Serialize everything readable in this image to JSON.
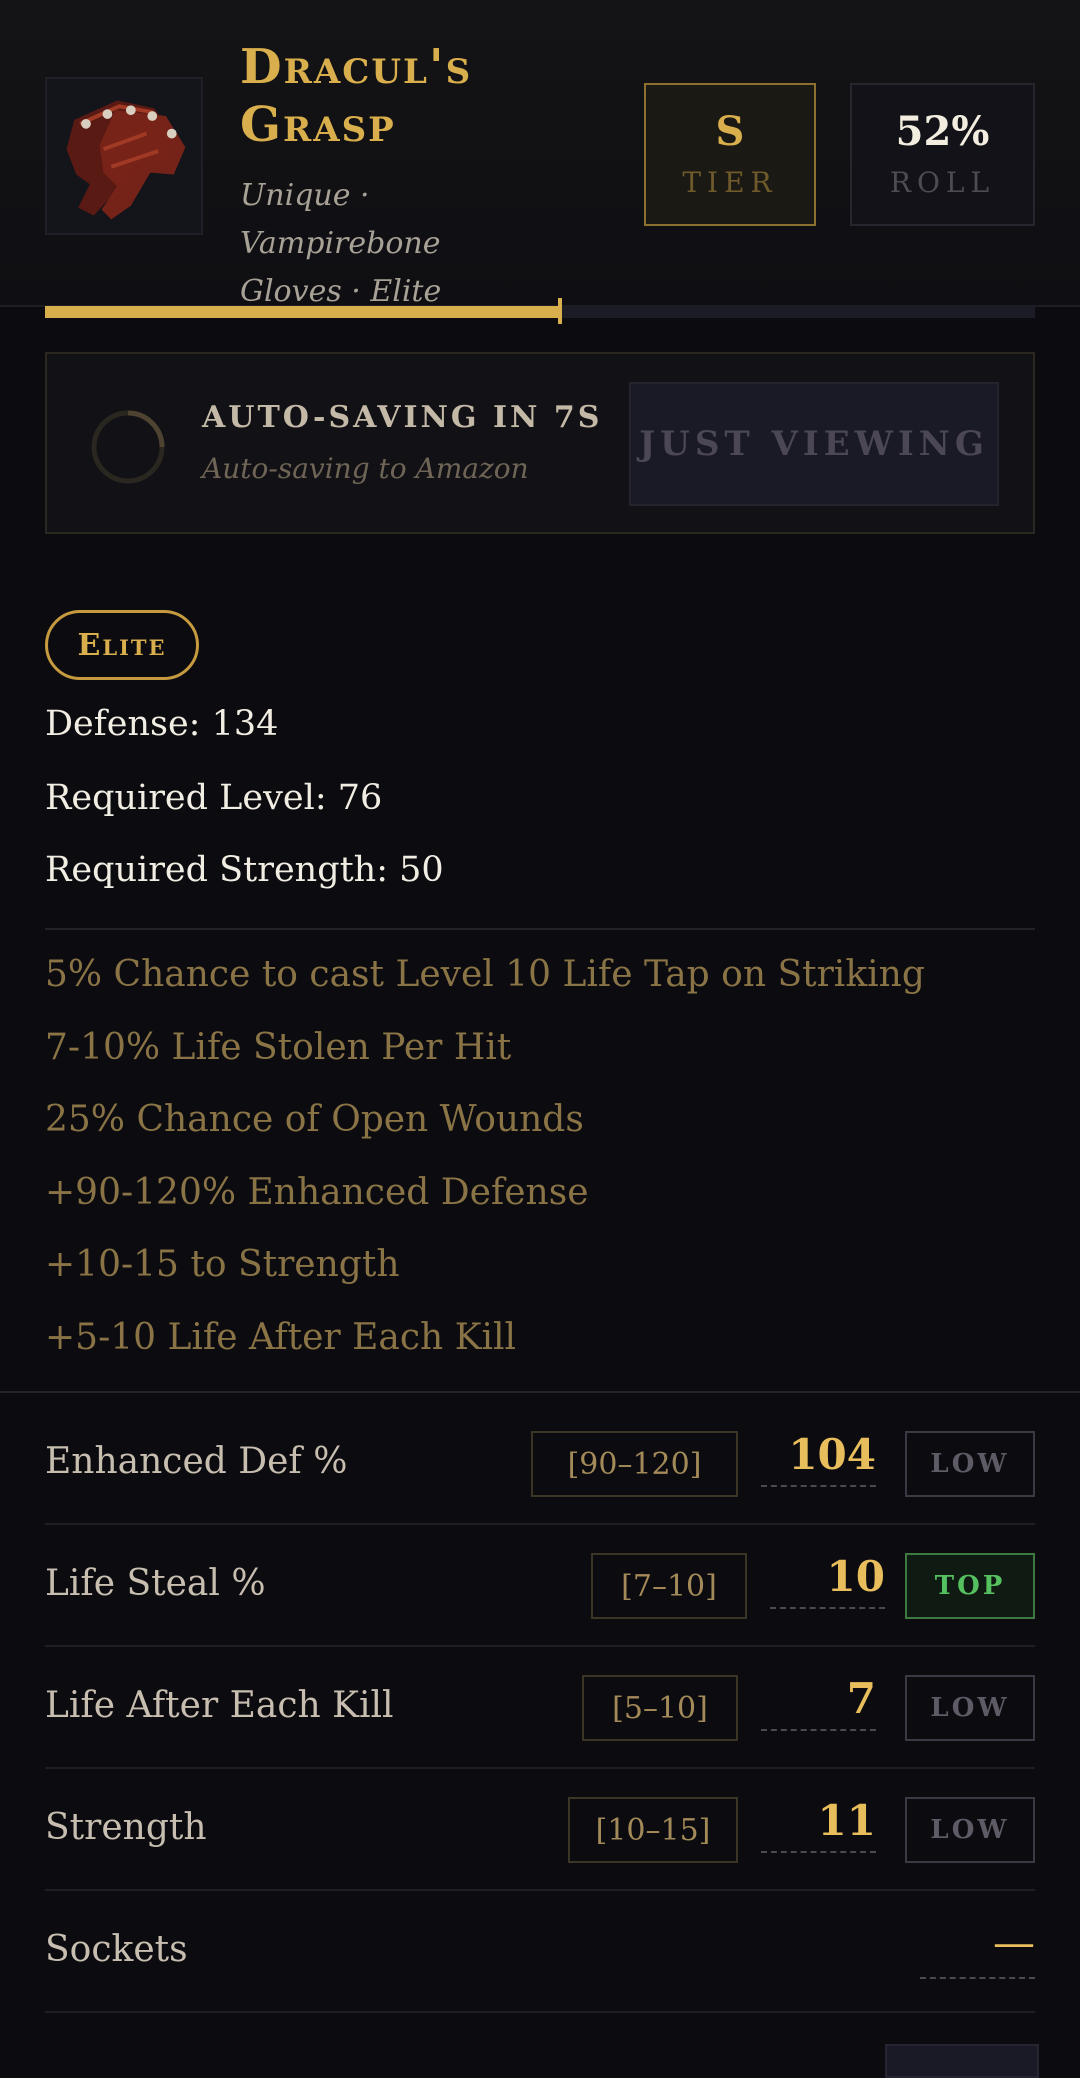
{
  "item": {
    "title_line1": "Dracul's",
    "title_line2": "Grasp",
    "subtitle_line1": "Unique · Vampirebone",
    "subtitle_line2": "Gloves · Elite",
    "icon": "gloves-item-icon"
  },
  "tier": {
    "value": "S",
    "label": "TIER"
  },
  "roll": {
    "value": "52%",
    "label": "ROLL",
    "fraction": 0.52
  },
  "autosave": {
    "title": "AUTO-SAVING IN 7S",
    "subtitle": "Auto-saving to Amazon",
    "button_label": "JUST VIEWING"
  },
  "badge": "Elite",
  "base_stats": [
    "Defense: 134",
    "Required Level: 76",
    "Required Strength: 50"
  ],
  "mods": [
    "5% Chance to cast Level 10 Life Tap on Striking",
    "7-10% Life Stolen Per Hit",
    "25% Chance of Open Wounds",
    "+90-120% Enhanced Defense",
    "+10-15 to Strength",
    "+5-10 Life After Each Kill"
  ],
  "rolls": [
    {
      "label": "Enhanced Def %",
      "range": "[90–120]",
      "value": "104",
      "rating": "LOW"
    },
    {
      "label": "Life Steal %",
      "range": "[7–10]",
      "value": "10",
      "rating": "TOP"
    },
    {
      "label": "Life After Each Kill",
      "range": "[5–10]",
      "value": "7",
      "rating": "LOW"
    },
    {
      "label": "Strength",
      "range": "[10–15]",
      "value": "11",
      "rating": "LOW"
    }
  ],
  "sockets": {
    "label": "Sockets",
    "value": "—"
  },
  "colors": {
    "gold": "#d9ae4c",
    "background": "#0b0b10",
    "mod_text": "#8a7446",
    "top_green": "#55c05f"
  }
}
